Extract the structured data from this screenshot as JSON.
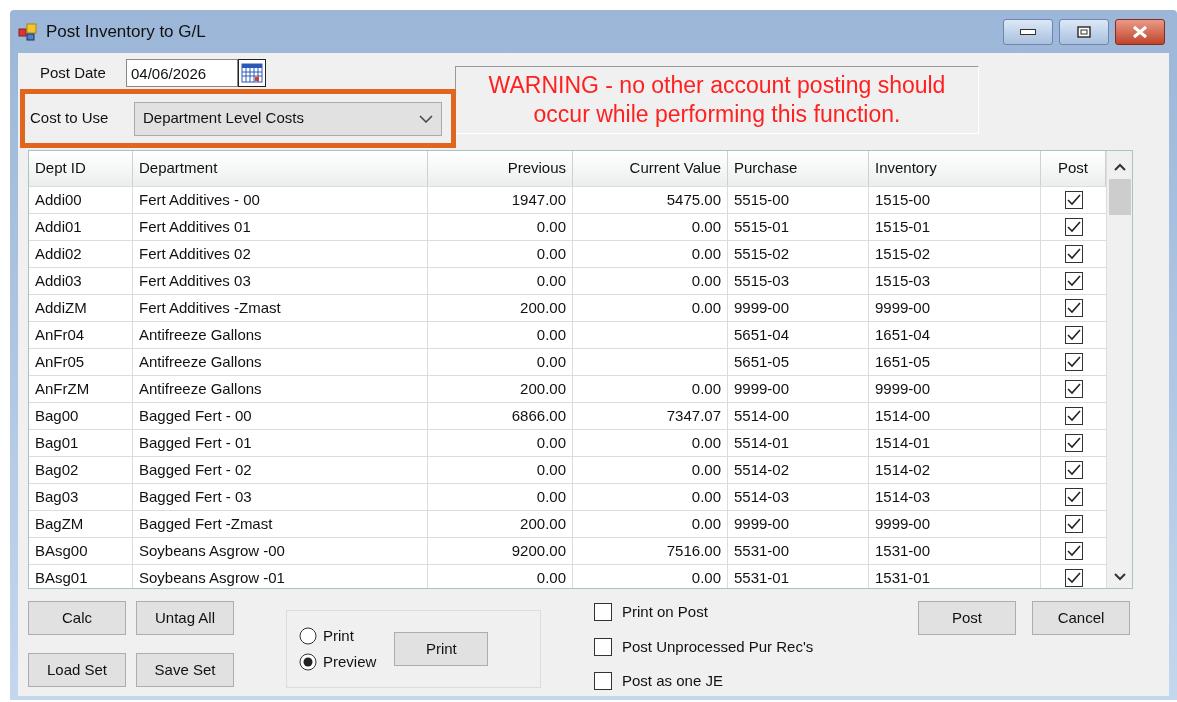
{
  "window": {
    "title": "Post Inventory to G/L"
  },
  "post_date": {
    "label": "Post Date",
    "value": "04/06/2026"
  },
  "cost_to_use": {
    "label": "Cost to Use",
    "value": "Department Level Costs",
    "highlighted": true
  },
  "warning": [
    "WARNING - no other account posting should",
    "occur while performing this function."
  ],
  "table": {
    "columns": [
      {
        "label": "Dept ID",
        "kind": "text"
      },
      {
        "label": "Department",
        "kind": "text"
      },
      {
        "label": "Previous",
        "kind": "number"
      },
      {
        "label": "Current Value",
        "kind": "number"
      },
      {
        "label": "Purchase",
        "kind": "text"
      },
      {
        "label": "Inventory",
        "kind": "text"
      },
      {
        "label": "Post",
        "kind": "checkbox"
      }
    ],
    "rows": [
      {
        "cells": [
          "Addi00",
          "Fert Additives - 00",
          "1947.00",
          "5475.00",
          "5515-00",
          "1515-00"
        ],
        "post": true
      },
      {
        "cells": [
          "Addi01",
          "Fert Additives 01",
          "0.00",
          "0.00",
          "5515-01",
          "1515-01"
        ],
        "post": true
      },
      {
        "cells": [
          "Addi02",
          "Fert Additives 02",
          "0.00",
          "0.00",
          "5515-02",
          "1515-02"
        ],
        "post": true
      },
      {
        "cells": [
          "Addi03",
          "Fert Additives 03",
          "0.00",
          "0.00",
          "5515-03",
          "1515-03"
        ],
        "post": true
      },
      {
        "cells": [
          "AddiZM",
          "Fert Additives -Zmast",
          "200.00",
          "0.00",
          "9999-00",
          "9999-00"
        ],
        "post": true
      },
      {
        "cells": [
          "AnFr04",
          "Antifreeze Gallons",
          "0.00",
          "",
          "5651-04",
          "1651-04"
        ],
        "post": true
      },
      {
        "cells": [
          "AnFr05",
          "Antifreeze Gallons",
          "0.00",
          "",
          "5651-05",
          "1651-05"
        ],
        "post": true
      },
      {
        "cells": [
          "AnFrZM",
          "Antifreeze Gallons",
          "200.00",
          "0.00",
          "9999-00",
          "9999-00"
        ],
        "post": true
      },
      {
        "cells": [
          "Bag00",
          "Bagged Fert - 00",
          "6866.00",
          "7347.07",
          "5514-00",
          "1514-00"
        ],
        "post": true
      },
      {
        "cells": [
          "Bag01",
          "Bagged Fert - 01",
          "0.00",
          "0.00",
          "5514-01",
          "1514-01"
        ],
        "post": true
      },
      {
        "cells": [
          "Bag02",
          "Bagged Fert - 02",
          "0.00",
          "0.00",
          "5514-02",
          "1514-02"
        ],
        "post": true
      },
      {
        "cells": [
          "Bag03",
          "Bagged Fert - 03",
          "0.00",
          "0.00",
          "5514-03",
          "1514-03"
        ],
        "post": true
      },
      {
        "cells": [
          "BagZM",
          "Bagged Fert -Zmast",
          "200.00",
          "0.00",
          "9999-00",
          "9999-00"
        ],
        "post": true
      },
      {
        "cells": [
          "BAsg00",
          "Soybeans Asgrow -00",
          "9200.00",
          "7516.00",
          "5531-00",
          "1531-00"
        ],
        "post": true
      },
      {
        "cells": [
          "BAsg01",
          "Soybeans Asgrow -01",
          "0.00",
          "0.00",
          "5531-01",
          "1531-01"
        ],
        "post": true
      }
    ]
  },
  "left_buttons": [
    "Calc",
    "Untag All",
    "Load Set",
    "Save Set"
  ],
  "output_options": [
    {
      "label": "Print",
      "selected": false
    },
    {
      "label": "Preview",
      "selected": true
    }
  ],
  "print_button": "Print",
  "options": [
    {
      "label": "Print on Post",
      "checked": false
    },
    {
      "label": "Post Unprocessed Pur Rec's",
      "checked": false
    },
    {
      "label": "Post as one JE",
      "checked": false
    }
  ],
  "action_buttons": [
    "Post",
    "Cancel"
  ]
}
